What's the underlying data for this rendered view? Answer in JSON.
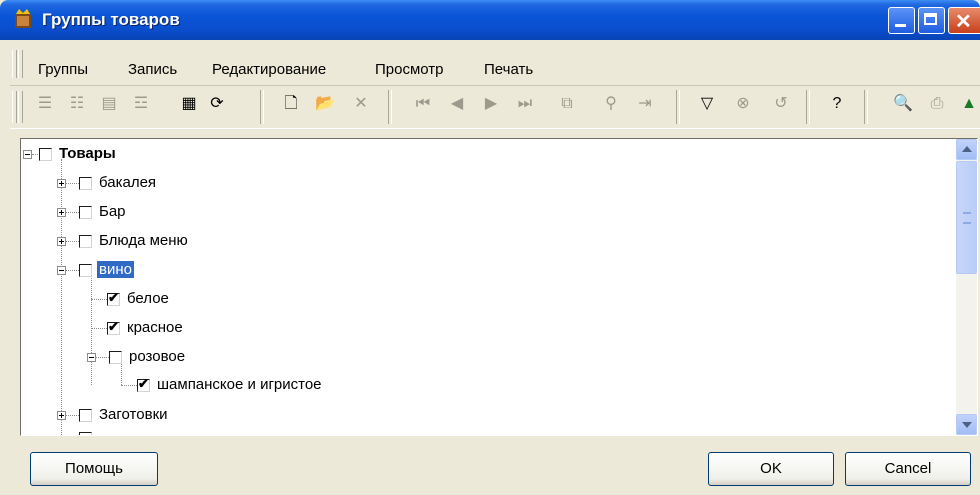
{
  "window": {
    "title": "Группы товаров"
  },
  "menu": {
    "items": [
      "Группы",
      "Запись",
      "Редактирование",
      "Просмотр",
      "Печать"
    ]
  },
  "tree": {
    "root": {
      "label": "Товары",
      "checked": false,
      "expanded": true
    },
    "nodes": [
      {
        "label": "бакалея",
        "checked": false
      },
      {
        "label": "Бар",
        "checked": false
      },
      {
        "label": "Блюда меню",
        "checked": false
      },
      {
        "label": "вино",
        "checked": false,
        "selected": true
      },
      {
        "label": "белое",
        "checked": true
      },
      {
        "label": "красное",
        "checked": true
      },
      {
        "label": "розовое",
        "checked": false
      },
      {
        "label": "шампанское и игристое",
        "checked": true
      },
      {
        "label": "Заготовки",
        "checked": false
      }
    ]
  },
  "buttons": {
    "help": "Помощь",
    "ok": "OK",
    "cancel": "Cancel"
  },
  "colors": {
    "titlebar": "#0a55d8",
    "selection": "#316ac5",
    "face": "#ece9d8"
  }
}
